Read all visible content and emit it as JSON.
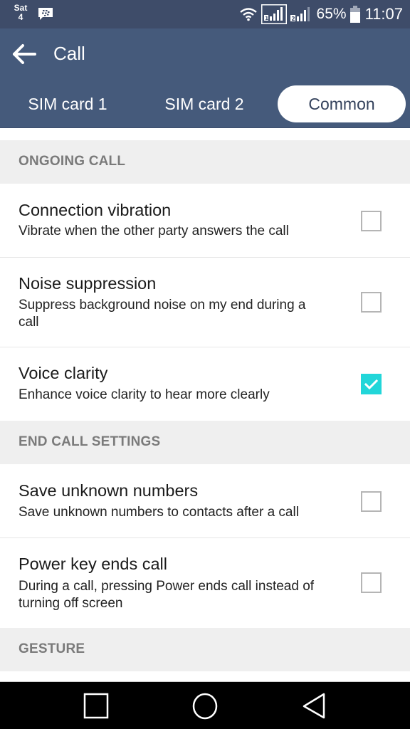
{
  "status_bar": {
    "day": "Sat",
    "date": "4",
    "notification_icon": "bbm-icon",
    "battery_percent": "65%",
    "time": "11:07",
    "icons": [
      "wifi-icon",
      "sim1-signal-icon",
      "sim2-signal-icon",
      "battery-icon"
    ]
  },
  "app_bar": {
    "back_icon": "arrow-left-icon",
    "title": "Call"
  },
  "tabs": [
    {
      "label": "SIM card 1",
      "selected": false
    },
    {
      "label": "SIM card 2",
      "selected": false
    },
    {
      "label": "Common",
      "selected": true
    }
  ],
  "sections": [
    {
      "header": "ONGOING CALL",
      "items": [
        {
          "title": "Connection vibration",
          "subtitle": "Vibrate when the other party answers the call",
          "checked": false
        },
        {
          "title": "Noise suppression",
          "subtitle": "Suppress background noise on my end during a call",
          "checked": false
        },
        {
          "title": "Voice clarity",
          "subtitle": "Enhance voice clarity to hear more clearly",
          "checked": true
        }
      ]
    },
    {
      "header": "END CALL SETTINGS",
      "items": [
        {
          "title": "Save unknown numbers",
          "subtitle": "Save unknown numbers to contacts after a call",
          "checked": false
        },
        {
          "title": "Power key ends call",
          "subtitle": "During a call, pressing Power ends call instead of turning off screen",
          "checked": false
        }
      ]
    },
    {
      "header": "GESTURE",
      "items": []
    }
  ],
  "nav_bar": {
    "buttons": [
      "recents-square-icon",
      "home-circle-icon",
      "back-triangle-icon"
    ]
  },
  "colors": {
    "status_bar": "#3e4c69",
    "app_bar": "#455a7b",
    "checkbox_checked": "#22d6d9",
    "section_header_bg": "#efefef",
    "section_header_text": "#7a7a7a"
  }
}
